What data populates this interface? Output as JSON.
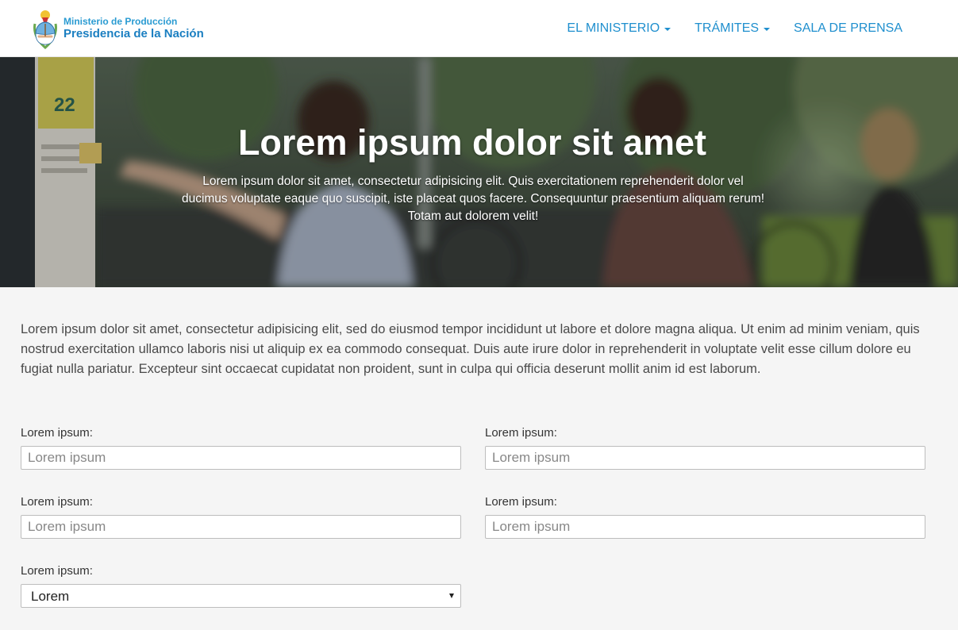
{
  "header": {
    "brand_line1": "Ministerio de Producción",
    "brand_line2": "Presidencia de la Nación",
    "nav": [
      {
        "label": "EL MINISTERIO",
        "has_dropdown": true
      },
      {
        "label": "TRÁMITES",
        "has_dropdown": true
      },
      {
        "label": "SALA DE PRENSA",
        "has_dropdown": false
      }
    ]
  },
  "hero": {
    "title": "Lorem ipsum dolor sit amet",
    "subtitle": "Lorem ipsum dolor sit amet, consectetur adipisicing elit. Quis exercitationem reprehenderit dolor vel ducimus voluptate eaque quo suscipit, iste placeat quos facere. Consequuntur praesentium aliquam rerum! Totam aut dolorem velit!",
    "sign_number": "22"
  },
  "intro": "Lorem ipsum dolor sit amet, consectetur adipisicing elit, sed do eiusmod tempor incididunt ut labore et dolore magna aliqua. Ut enim ad minim veniam, quis nostrud exercitation ullamco laboris nisi ut aliquip ex ea commodo consequat. Duis aute irure dolor in reprehenderit in voluptate velit esse cillum dolore eu fugiat nulla pariatur. Excepteur sint occaecat cupidatat non proident, sunt in culpa qui officia deserunt mollit anim id est laborum.",
  "form": {
    "fields": [
      {
        "label": "Lorem ipsum:",
        "placeholder": "Lorem ipsum",
        "value": ""
      },
      {
        "label": "Lorem ipsum:",
        "placeholder": "Lorem ipsum",
        "value": ""
      },
      {
        "label": "Lorem ipsum:",
        "placeholder": "Lorem ipsum",
        "value": ""
      },
      {
        "label": "Lorem ipsum:",
        "placeholder": "Lorem ipsum",
        "value": ""
      }
    ],
    "select": {
      "label": "Lorem ipsum:",
      "selected": "Lorem"
    }
  },
  "colors": {
    "brand_blue": "#1f8fce",
    "page_background": "#f5f5f5",
    "text": "#4a4a4a"
  }
}
